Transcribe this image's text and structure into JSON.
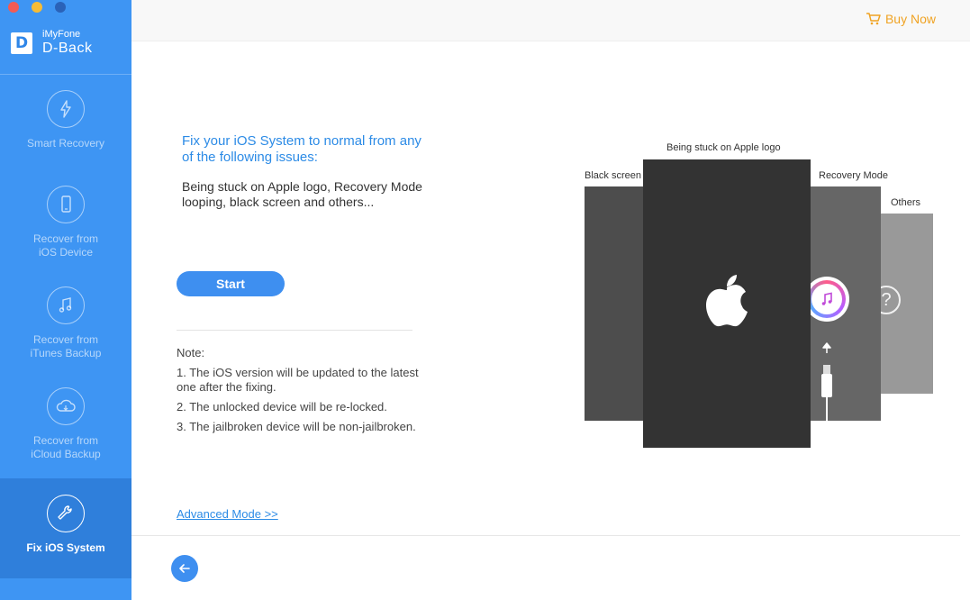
{
  "window": {
    "controls": [
      "close",
      "minimize",
      "zoom"
    ]
  },
  "brand": {
    "logo_letter": "D",
    "sub": "iMyFone",
    "name": "D-Back"
  },
  "sidebar": {
    "items": [
      {
        "label": "Smart Recovery",
        "icon": "lightning-icon",
        "active": false
      },
      {
        "label": "Recover from\niOS Device",
        "icon": "phone-icon",
        "active": false
      },
      {
        "label": "Recover from\niTunes Backup",
        "icon": "music-note-icon",
        "active": false
      },
      {
        "label": "Recover from\niCloud Backup",
        "icon": "cloud-icon",
        "active": false
      },
      {
        "label": "Fix iOS System",
        "icon": "wrench-icon",
        "active": true
      }
    ]
  },
  "header": {
    "buy_now": "Buy Now"
  },
  "main": {
    "title": "Fix your iOS System to normal from any of the following issues:",
    "body": "Being stuck on Apple logo, Recovery Mode looping, black screen and others...",
    "start_label": "Start",
    "note_title": "Note:",
    "notes": [
      "1. The iOS version will be updated to the latest one after the fixing.",
      "2. The unlocked device will be re-locked.",
      "3. The jailbroken device will be non-jailbroken."
    ],
    "advanced_link": "Advanced Mode >>"
  },
  "illustration": {
    "labels": {
      "main": "Being stuck on Apple logo",
      "black": "Black screen",
      "recovery": "Recovery Mode",
      "others": "Others"
    },
    "others_symbol": "?"
  },
  "colors": {
    "sidebar": "#3e95f3",
    "sidebar_active": "#2f7fdb",
    "accent": "#2c8be6",
    "buy_now": "#f0a323"
  }
}
